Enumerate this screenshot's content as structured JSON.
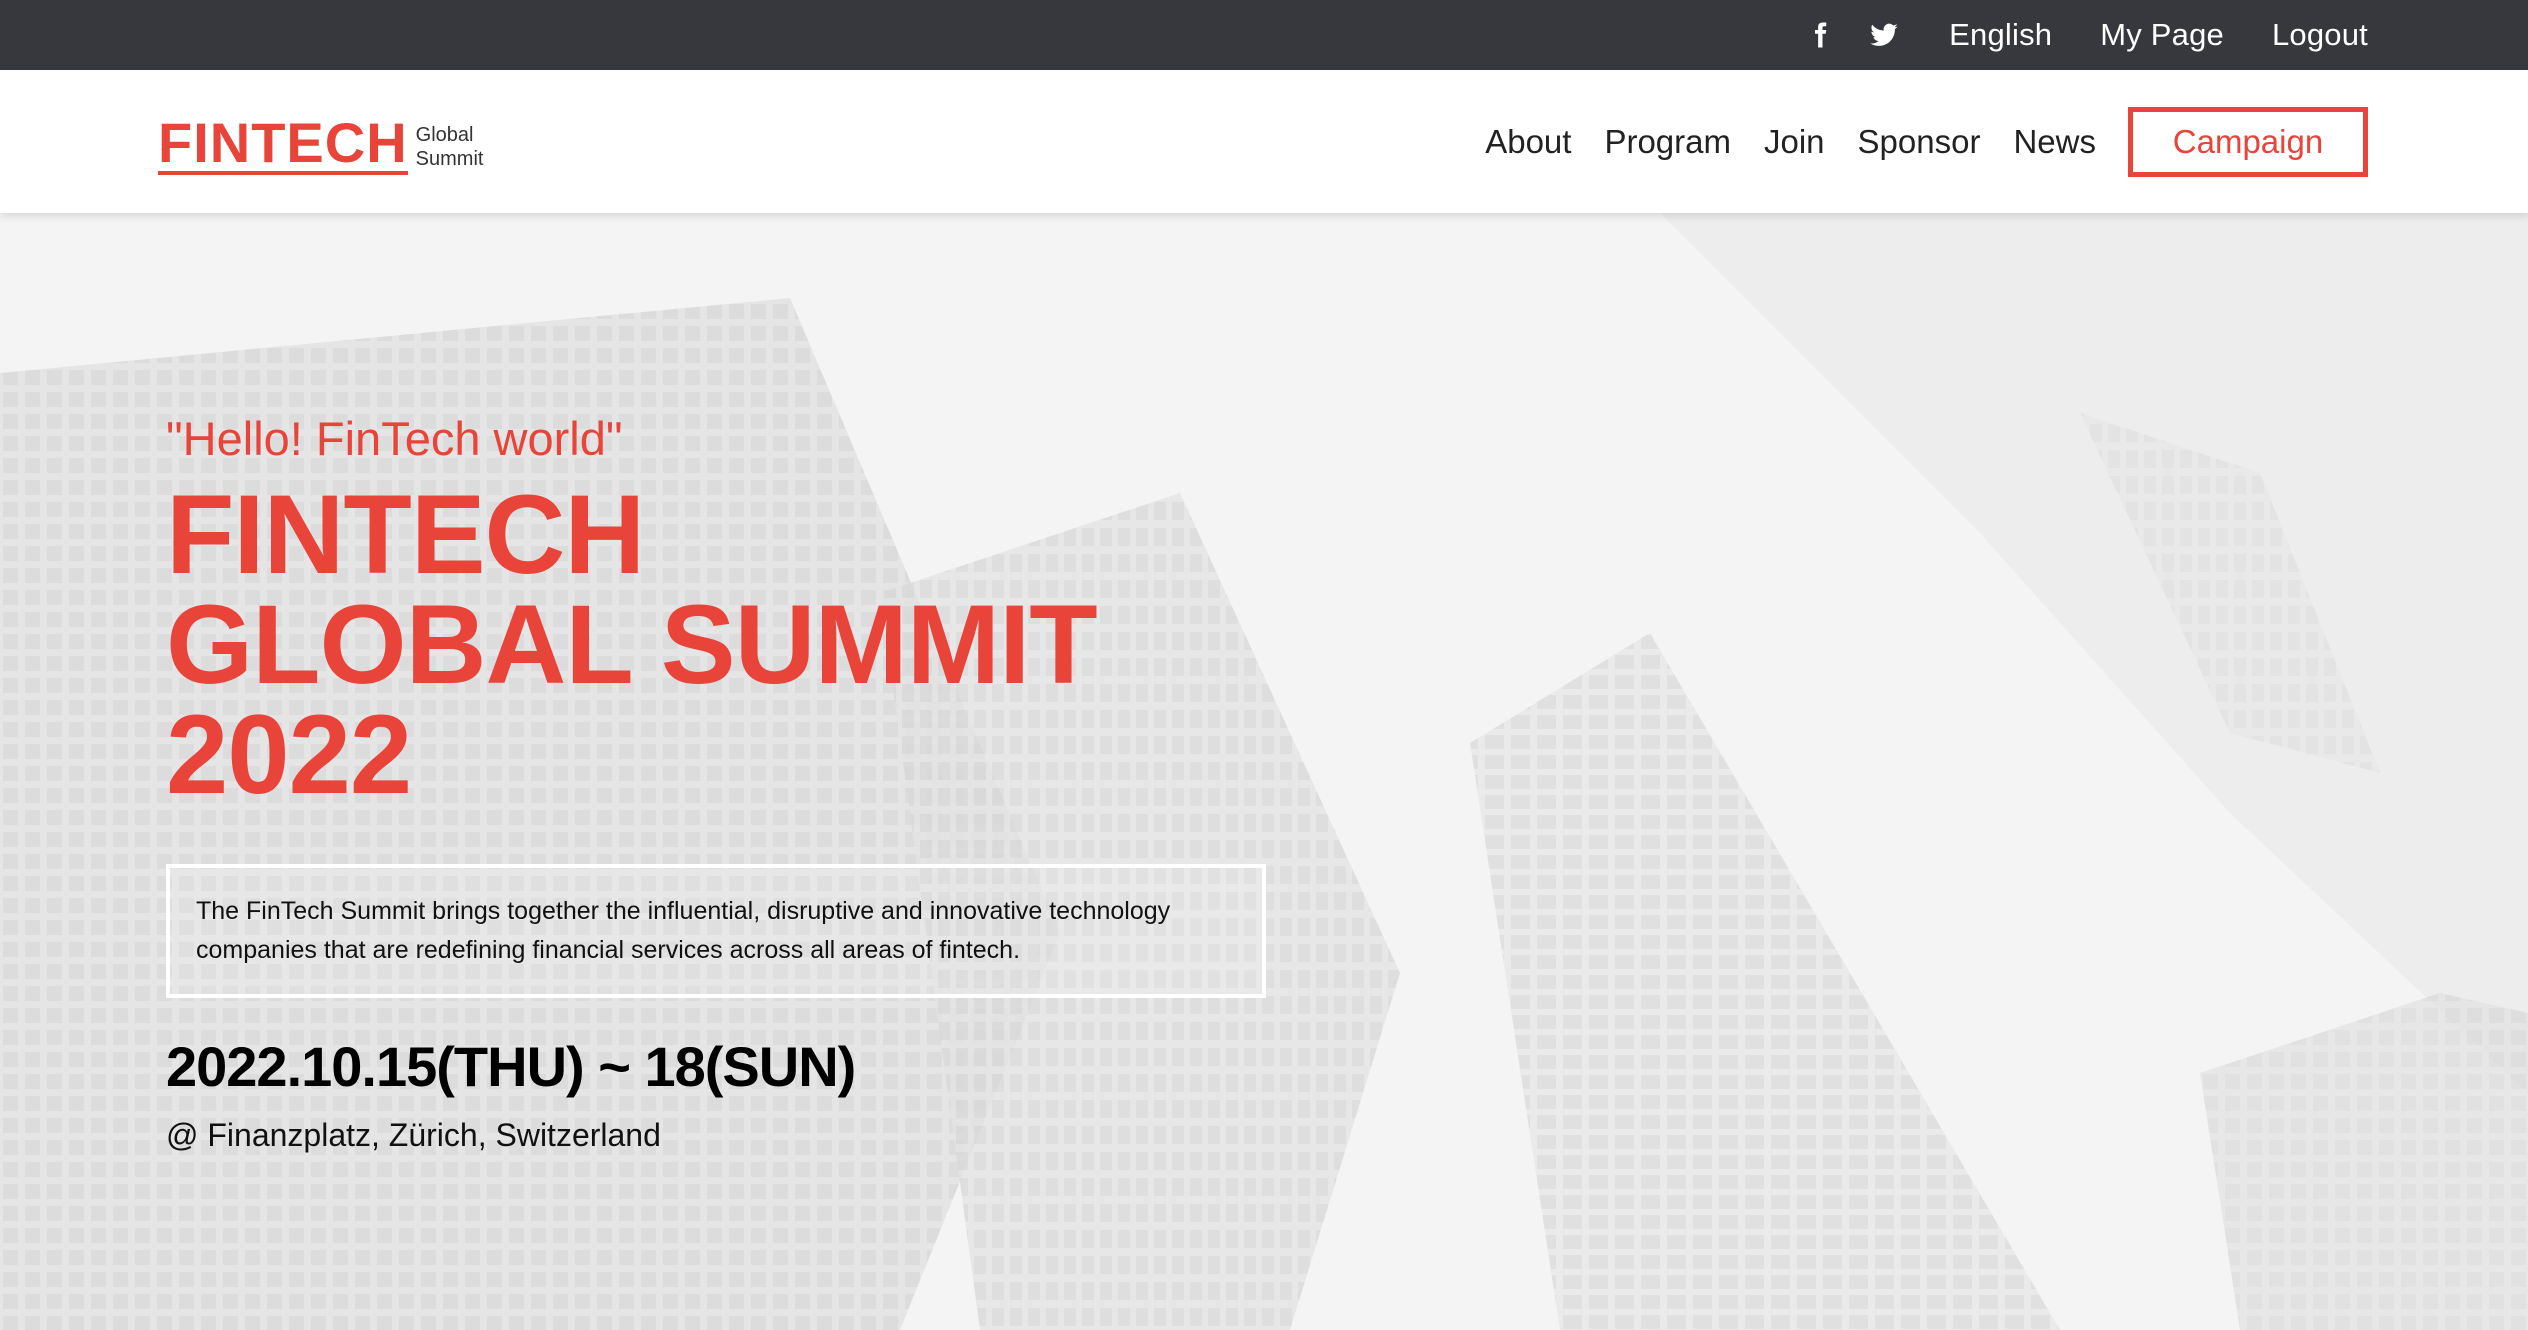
{
  "topbar": {
    "icons": [
      "facebook-icon",
      "twitter-icon"
    ],
    "language": "English",
    "my_page": "My Page",
    "logout": "Logout"
  },
  "header": {
    "logo_main": "FINTECH",
    "logo_sub_line1": "Global",
    "logo_sub_line2": "Summit",
    "nav": [
      "About",
      "Program",
      "Join",
      "Sponsor",
      "News"
    ],
    "cta": "Campaign"
  },
  "hero": {
    "tagline": "\"Hello! FinTech world\"",
    "title_line1": "FINTECH",
    "title_line2": "GLOBAL SUMMIT",
    "title_line3": "2022",
    "description_line1": "The FinTech Summit brings together the influential, disruptive and innovative technology",
    "description_line2": "companies that are redefining financial services across all areas of fintech.",
    "date": "2022.10.15(THU) ~ 18(SUN)",
    "location": "@ Finanzplatz, Zürich, Switzerland"
  },
  "colors": {
    "accent": "#e8443a",
    "topbar_bg": "#37383d",
    "text_dark": "#222222"
  }
}
